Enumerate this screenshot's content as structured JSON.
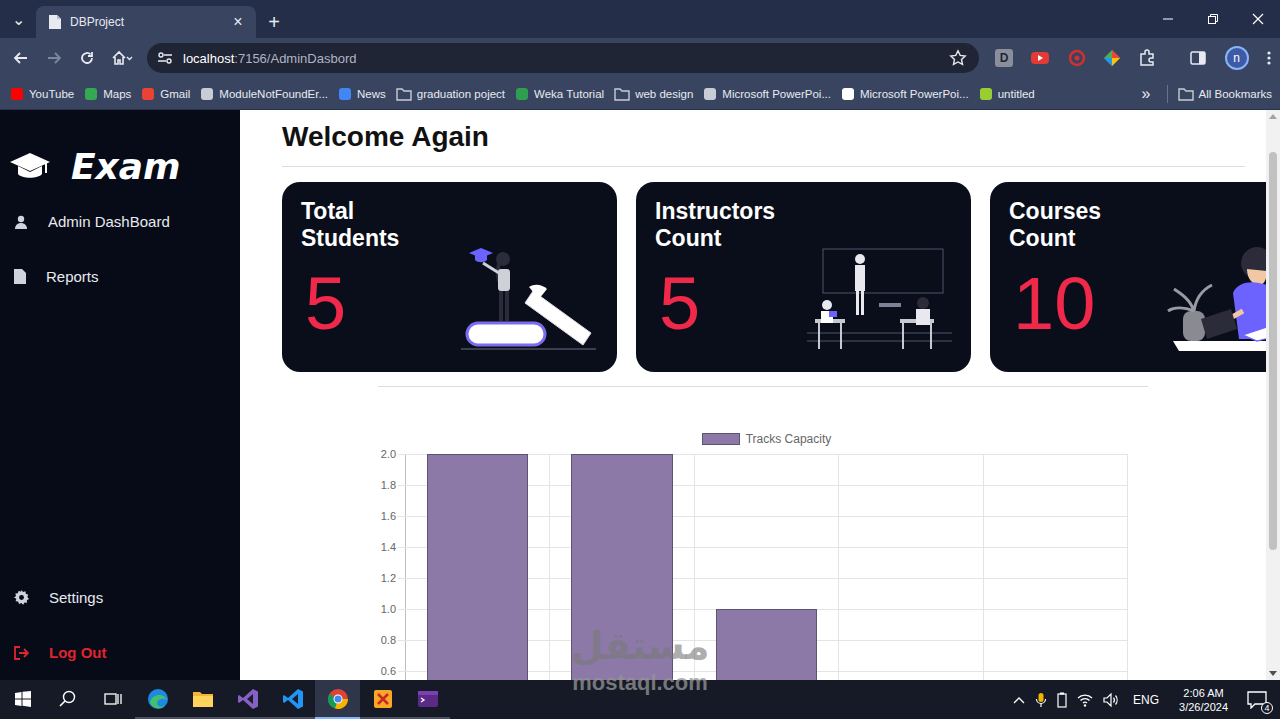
{
  "browser": {
    "tab_menu": "⌄",
    "tabs": [
      {
        "title": "DBProject",
        "close": "×",
        "selected": true
      }
    ],
    "new_tab": "+",
    "address": {
      "host": "localhost",
      "path": ":7156/AdminDasbord"
    },
    "extension_letter": "D",
    "profile_initial": "n",
    "bookmarks": [
      {
        "label": "YouTube",
        "kind": "site",
        "color": "#ff0000"
      },
      {
        "label": "Maps",
        "kind": "site",
        "color": "#34a853"
      },
      {
        "label": "Gmail",
        "kind": "site",
        "color": "#ea4335"
      },
      {
        "label": "ModuleNotFoundEr...",
        "kind": "site",
        "color": "#c8ccd4"
      },
      {
        "label": "News",
        "kind": "site",
        "color": "#4285f4"
      },
      {
        "label": "graduation poject",
        "kind": "folder",
        "color": "#c8ccd4"
      },
      {
        "label": "Weka Tutorial",
        "kind": "site",
        "color": "#2e9e4f"
      },
      {
        "label": "web design",
        "kind": "folder",
        "color": "#c8ccd4"
      },
      {
        "label": "Microsoft PowerPoi...",
        "kind": "site",
        "color": "#c8ccd4"
      },
      {
        "label": "Microsoft PowerPoi...",
        "kind": "site",
        "color": "#ffffff"
      },
      {
        "label": "untitled",
        "kind": "site",
        "color": "#9acd32"
      }
    ],
    "bookmarks_more": "»",
    "all_bookmarks": "All Bookmarks"
  },
  "sidebar": {
    "logo": "Exam",
    "items": [
      {
        "label": "Admin DashBoard",
        "kind": "dashboard"
      },
      {
        "label": "Reports",
        "kind": "reports"
      }
    ],
    "bottom_items": [
      {
        "label": "Settings",
        "kind": "settings"
      },
      {
        "label": "Log Out",
        "kind": "logout"
      }
    ]
  },
  "page": {
    "heading": "Welcome Again",
    "cards": [
      {
        "title": "Total Students",
        "value": "5",
        "kind": "books"
      },
      {
        "title": "Instructors Count",
        "value": "5",
        "kind": "classroom"
      },
      {
        "title": "Courses Count",
        "value": "10",
        "kind": "desk"
      }
    ]
  },
  "chart": {
    "legend": "Tracks Capacity",
    "y_ticks": [
      "2.0",
      "1.8",
      "1.6",
      "1.4",
      "1.2",
      "1.0",
      "0.8",
      "0.6"
    ],
    "series": [
      {
        "name": "Tracks Capacity",
        "values": [
          2,
          2,
          1,
          0,
          0
        ]
      }
    ]
  },
  "taskbar": {
    "apps": [
      {
        "kind": "edge",
        "selected": false
      },
      {
        "kind": "explorer",
        "selected": false
      },
      {
        "kind": "studio",
        "selected": false
      },
      {
        "kind": "vscode",
        "selected": false
      },
      {
        "kind": "chrome",
        "selected": true
      },
      {
        "kind": "paint",
        "selected": false
      },
      {
        "kind": "terminal",
        "selected": false
      }
    ],
    "language": "ENG",
    "time": "2:06 AM",
    "date": "3/26/2024",
    "notifications": "4"
  },
  "watermark": {
    "arabic": "مستقل",
    "latin": "mostaql.com"
  }
}
